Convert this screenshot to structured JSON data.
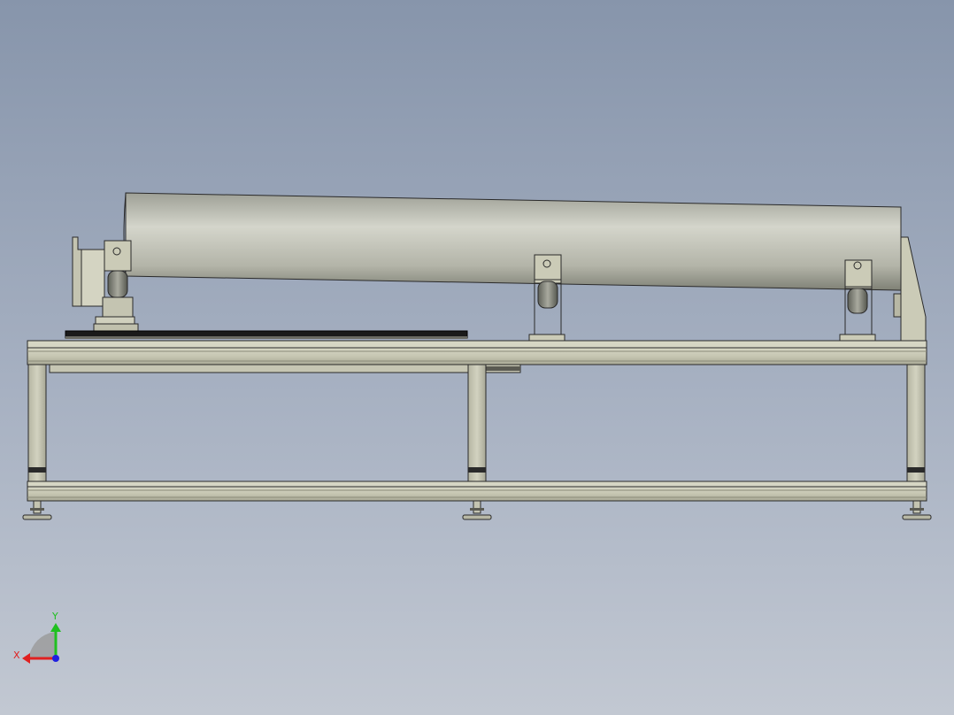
{
  "viewport": {
    "background_top": "#8795ab",
    "background_bottom": "#c2c8d2"
  },
  "model": {
    "part_color": "#cbcbb7",
    "part_shadow": "#9c9c8a",
    "edge_color": "#2a2a2a",
    "tube_color": "#bfc0b5",
    "rail_color": "#1a1a1a"
  },
  "triad": {
    "x_label": "X",
    "y_label": "Y",
    "x_color": "#e02020",
    "y_color": "#20c020",
    "z_color": "#2020e0"
  }
}
